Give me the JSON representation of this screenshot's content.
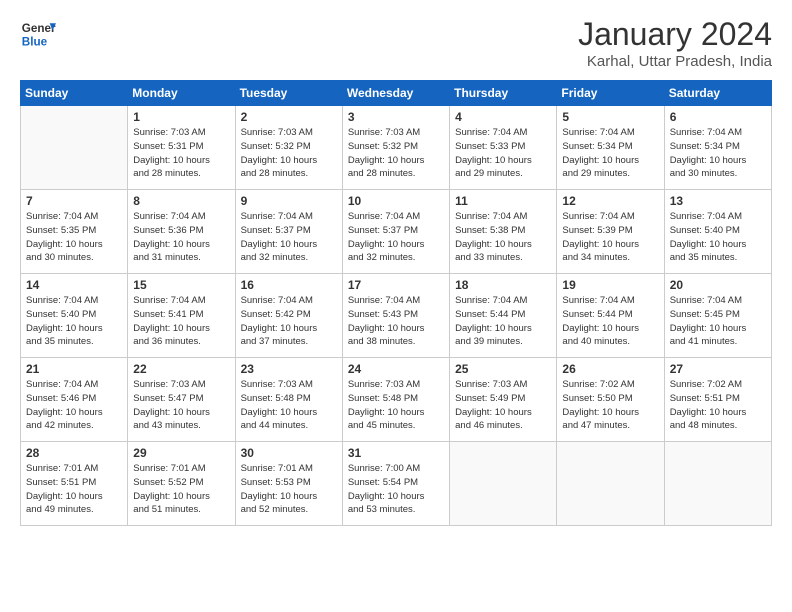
{
  "header": {
    "logo_general": "General",
    "logo_blue": "Blue",
    "month_title": "January 2024",
    "location": "Karhal, Uttar Pradesh, India"
  },
  "days_of_week": [
    "Sunday",
    "Monday",
    "Tuesday",
    "Wednesday",
    "Thursday",
    "Friday",
    "Saturday"
  ],
  "weeks": [
    [
      {
        "day": "",
        "info": ""
      },
      {
        "day": "1",
        "info": "Sunrise: 7:03 AM\nSunset: 5:31 PM\nDaylight: 10 hours\nand 28 minutes."
      },
      {
        "day": "2",
        "info": "Sunrise: 7:03 AM\nSunset: 5:32 PM\nDaylight: 10 hours\nand 28 minutes."
      },
      {
        "day": "3",
        "info": "Sunrise: 7:03 AM\nSunset: 5:32 PM\nDaylight: 10 hours\nand 28 minutes."
      },
      {
        "day": "4",
        "info": "Sunrise: 7:04 AM\nSunset: 5:33 PM\nDaylight: 10 hours\nand 29 minutes."
      },
      {
        "day": "5",
        "info": "Sunrise: 7:04 AM\nSunset: 5:34 PM\nDaylight: 10 hours\nand 29 minutes."
      },
      {
        "day": "6",
        "info": "Sunrise: 7:04 AM\nSunset: 5:34 PM\nDaylight: 10 hours\nand 30 minutes."
      }
    ],
    [
      {
        "day": "7",
        "info": "Sunrise: 7:04 AM\nSunset: 5:35 PM\nDaylight: 10 hours\nand 30 minutes."
      },
      {
        "day": "8",
        "info": "Sunrise: 7:04 AM\nSunset: 5:36 PM\nDaylight: 10 hours\nand 31 minutes."
      },
      {
        "day": "9",
        "info": "Sunrise: 7:04 AM\nSunset: 5:37 PM\nDaylight: 10 hours\nand 32 minutes."
      },
      {
        "day": "10",
        "info": "Sunrise: 7:04 AM\nSunset: 5:37 PM\nDaylight: 10 hours\nand 32 minutes."
      },
      {
        "day": "11",
        "info": "Sunrise: 7:04 AM\nSunset: 5:38 PM\nDaylight: 10 hours\nand 33 minutes."
      },
      {
        "day": "12",
        "info": "Sunrise: 7:04 AM\nSunset: 5:39 PM\nDaylight: 10 hours\nand 34 minutes."
      },
      {
        "day": "13",
        "info": "Sunrise: 7:04 AM\nSunset: 5:40 PM\nDaylight: 10 hours\nand 35 minutes."
      }
    ],
    [
      {
        "day": "14",
        "info": "Sunrise: 7:04 AM\nSunset: 5:40 PM\nDaylight: 10 hours\nand 35 minutes."
      },
      {
        "day": "15",
        "info": "Sunrise: 7:04 AM\nSunset: 5:41 PM\nDaylight: 10 hours\nand 36 minutes."
      },
      {
        "day": "16",
        "info": "Sunrise: 7:04 AM\nSunset: 5:42 PM\nDaylight: 10 hours\nand 37 minutes."
      },
      {
        "day": "17",
        "info": "Sunrise: 7:04 AM\nSunset: 5:43 PM\nDaylight: 10 hours\nand 38 minutes."
      },
      {
        "day": "18",
        "info": "Sunrise: 7:04 AM\nSunset: 5:44 PM\nDaylight: 10 hours\nand 39 minutes."
      },
      {
        "day": "19",
        "info": "Sunrise: 7:04 AM\nSunset: 5:44 PM\nDaylight: 10 hours\nand 40 minutes."
      },
      {
        "day": "20",
        "info": "Sunrise: 7:04 AM\nSunset: 5:45 PM\nDaylight: 10 hours\nand 41 minutes."
      }
    ],
    [
      {
        "day": "21",
        "info": "Sunrise: 7:04 AM\nSunset: 5:46 PM\nDaylight: 10 hours\nand 42 minutes."
      },
      {
        "day": "22",
        "info": "Sunrise: 7:03 AM\nSunset: 5:47 PM\nDaylight: 10 hours\nand 43 minutes."
      },
      {
        "day": "23",
        "info": "Sunrise: 7:03 AM\nSunset: 5:48 PM\nDaylight: 10 hours\nand 44 minutes."
      },
      {
        "day": "24",
        "info": "Sunrise: 7:03 AM\nSunset: 5:48 PM\nDaylight: 10 hours\nand 45 minutes."
      },
      {
        "day": "25",
        "info": "Sunrise: 7:03 AM\nSunset: 5:49 PM\nDaylight: 10 hours\nand 46 minutes."
      },
      {
        "day": "26",
        "info": "Sunrise: 7:02 AM\nSunset: 5:50 PM\nDaylight: 10 hours\nand 47 minutes."
      },
      {
        "day": "27",
        "info": "Sunrise: 7:02 AM\nSunset: 5:51 PM\nDaylight: 10 hours\nand 48 minutes."
      }
    ],
    [
      {
        "day": "28",
        "info": "Sunrise: 7:01 AM\nSunset: 5:51 PM\nDaylight: 10 hours\nand 49 minutes."
      },
      {
        "day": "29",
        "info": "Sunrise: 7:01 AM\nSunset: 5:52 PM\nDaylight: 10 hours\nand 51 minutes."
      },
      {
        "day": "30",
        "info": "Sunrise: 7:01 AM\nSunset: 5:53 PM\nDaylight: 10 hours\nand 52 minutes."
      },
      {
        "day": "31",
        "info": "Sunrise: 7:00 AM\nSunset: 5:54 PM\nDaylight: 10 hours\nand 53 minutes."
      },
      {
        "day": "",
        "info": ""
      },
      {
        "day": "",
        "info": ""
      },
      {
        "day": "",
        "info": ""
      }
    ]
  ]
}
